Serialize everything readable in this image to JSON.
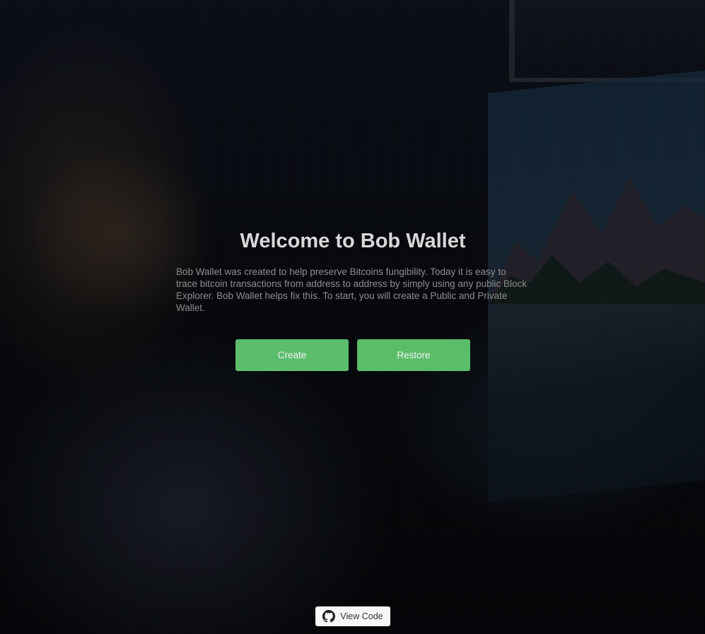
{
  "page": {
    "title": "Welcome to Bob Wallet",
    "description": "Bob Wallet was created to help preserve Bitcoins fungibility. Today it is easy to trace bitcoin transactions from address to address by simply using any public Block Explorer. Bob Wallet helps fix this. To start, you will create a Public and Private Wallet."
  },
  "actions": {
    "create_label": "Create",
    "restore_label": "Restore"
  },
  "footer": {
    "view_code_label": "View Code",
    "icon": "github-icon"
  },
  "colors": {
    "button": "#5cbe6c",
    "overlay": "#000000",
    "title": "#d8d8d8",
    "description": "#8e8e8e"
  }
}
